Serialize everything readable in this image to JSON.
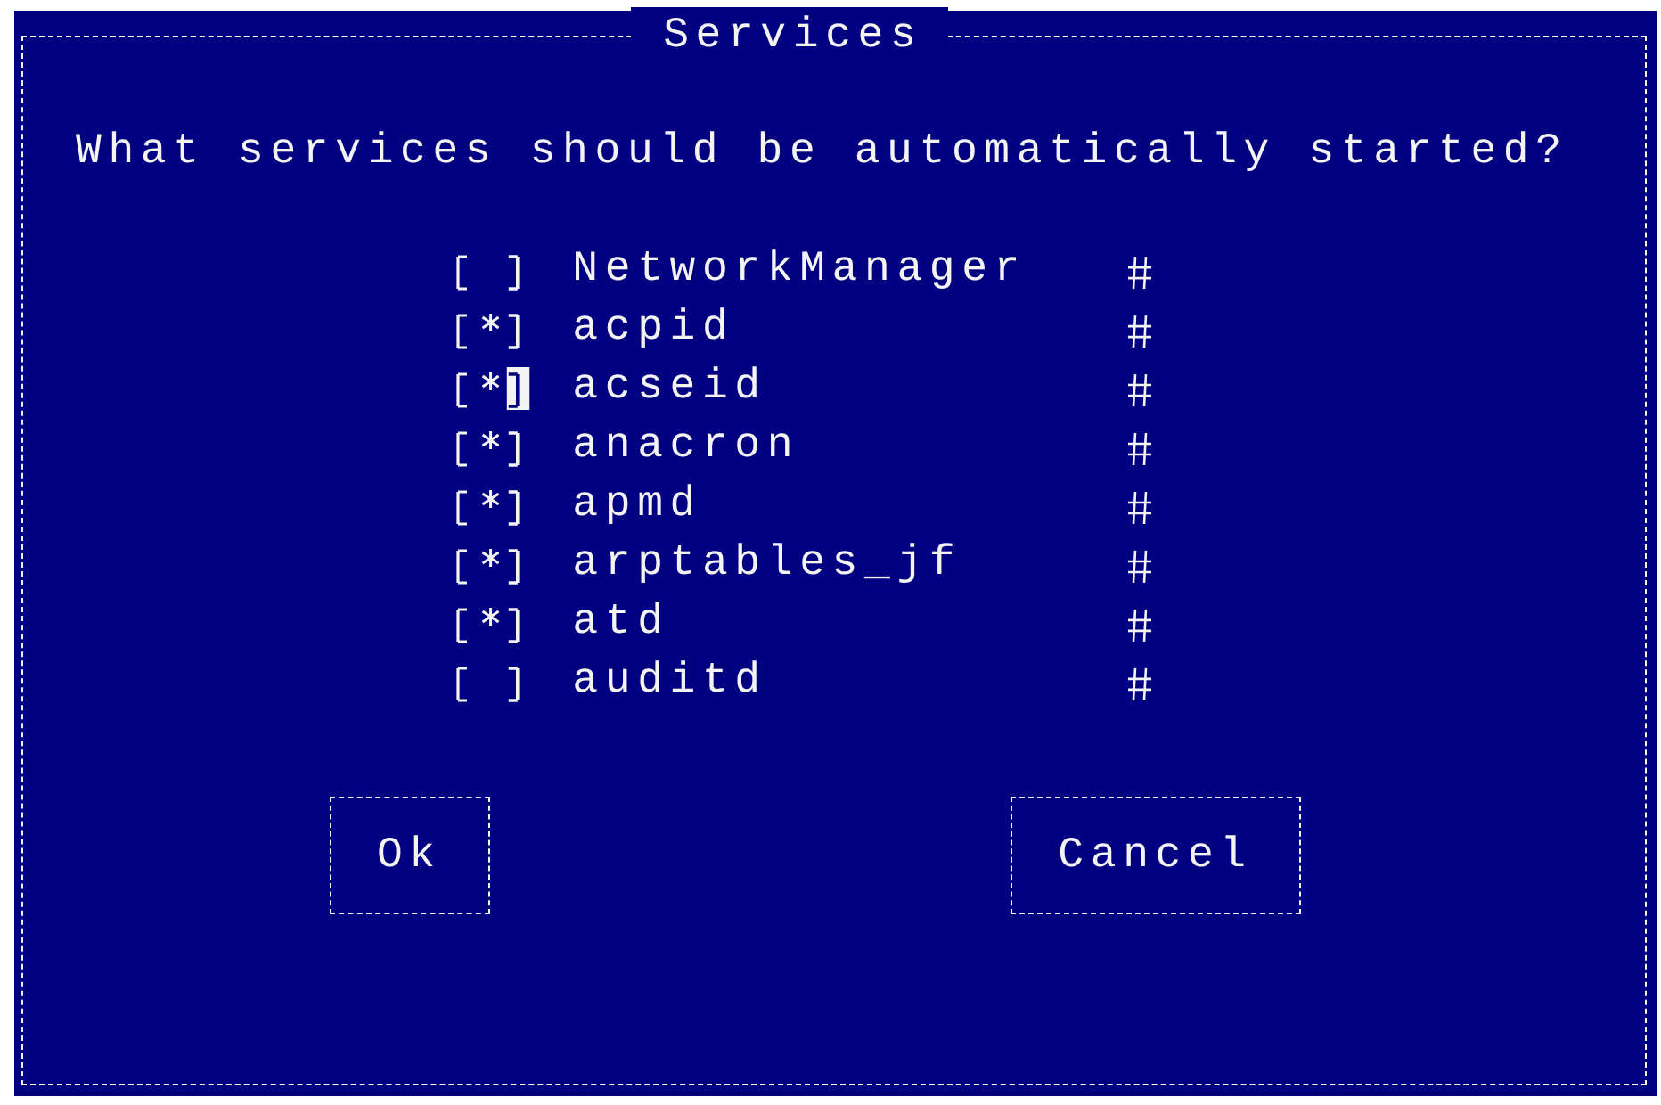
{
  "dialog": {
    "title": "Services",
    "prompt": "What services should be automatically started?",
    "services": [
      {
        "name": "NetworkManager",
        "checked": false,
        "focused": false
      },
      {
        "name": "acpid",
        "checked": true,
        "focused": false
      },
      {
        "name": "acseid",
        "checked": true,
        "focused": true
      },
      {
        "name": "anacron",
        "checked": true,
        "focused": false
      },
      {
        "name": "apmd",
        "checked": true,
        "focused": false
      },
      {
        "name": "arptables_jf",
        "checked": true,
        "focused": false
      },
      {
        "name": "atd",
        "checked": true,
        "focused": false
      },
      {
        "name": "auditd",
        "checked": false,
        "focused": false
      }
    ],
    "buttons": [
      {
        "label": "Ok"
      },
      {
        "label": "Cancel"
      }
    ]
  }
}
